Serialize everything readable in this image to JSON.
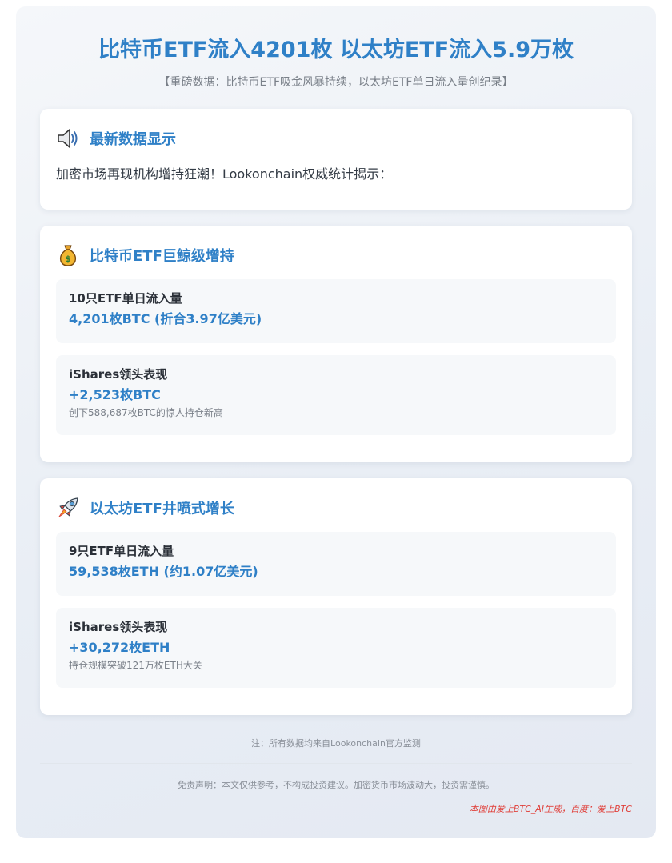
{
  "header": {
    "title": "比特币ETF流入4201枚 以太坊ETF流入5.9万枚",
    "subtitle": "【重磅数据：比特币ETF吸金风暴持续，以太坊ETF单日流入量创纪录】"
  },
  "cards": [
    {
      "icon": "speaker-icon",
      "title": "最新数据显示",
      "text": "加密市场再现机构增持狂潮！Lookonchain权威统计揭示："
    },
    {
      "icon": "money-bag-icon",
      "title": "比特币ETF巨鲸级增持",
      "items": [
        {
          "label": "10只ETF单日流入量",
          "value": "4,201枚BTC (折合3.97亿美元)"
        },
        {
          "label": "iShares领头表现",
          "value": "+2,523枚BTC",
          "note": "创下588,687枚BTC的惊人持仓新高"
        }
      ]
    },
    {
      "icon": "rocket-icon",
      "title": "以太坊ETF井喷式增长",
      "items": [
        {
          "label": "9只ETF单日流入量",
          "value": "59,538枚ETH (约1.07亿美元)"
        },
        {
          "label": "iShares领头表现",
          "value": "+30,272枚ETH",
          "note": "持仓规模突破121万枚ETH大关"
        }
      ]
    }
  ],
  "footer": {
    "note": "注：所有数据均来自Lookonchain官方监测",
    "disclaimer": "免责声明：本文仅供参考，不构成投资建议。加密货币市场波动大，投资需谨慎。",
    "credit": "本图由爱上BTC_AI生成，百度：爱上BTC"
  },
  "colors": {
    "accent": "#2f80c7",
    "credit": "#e0403a"
  }
}
